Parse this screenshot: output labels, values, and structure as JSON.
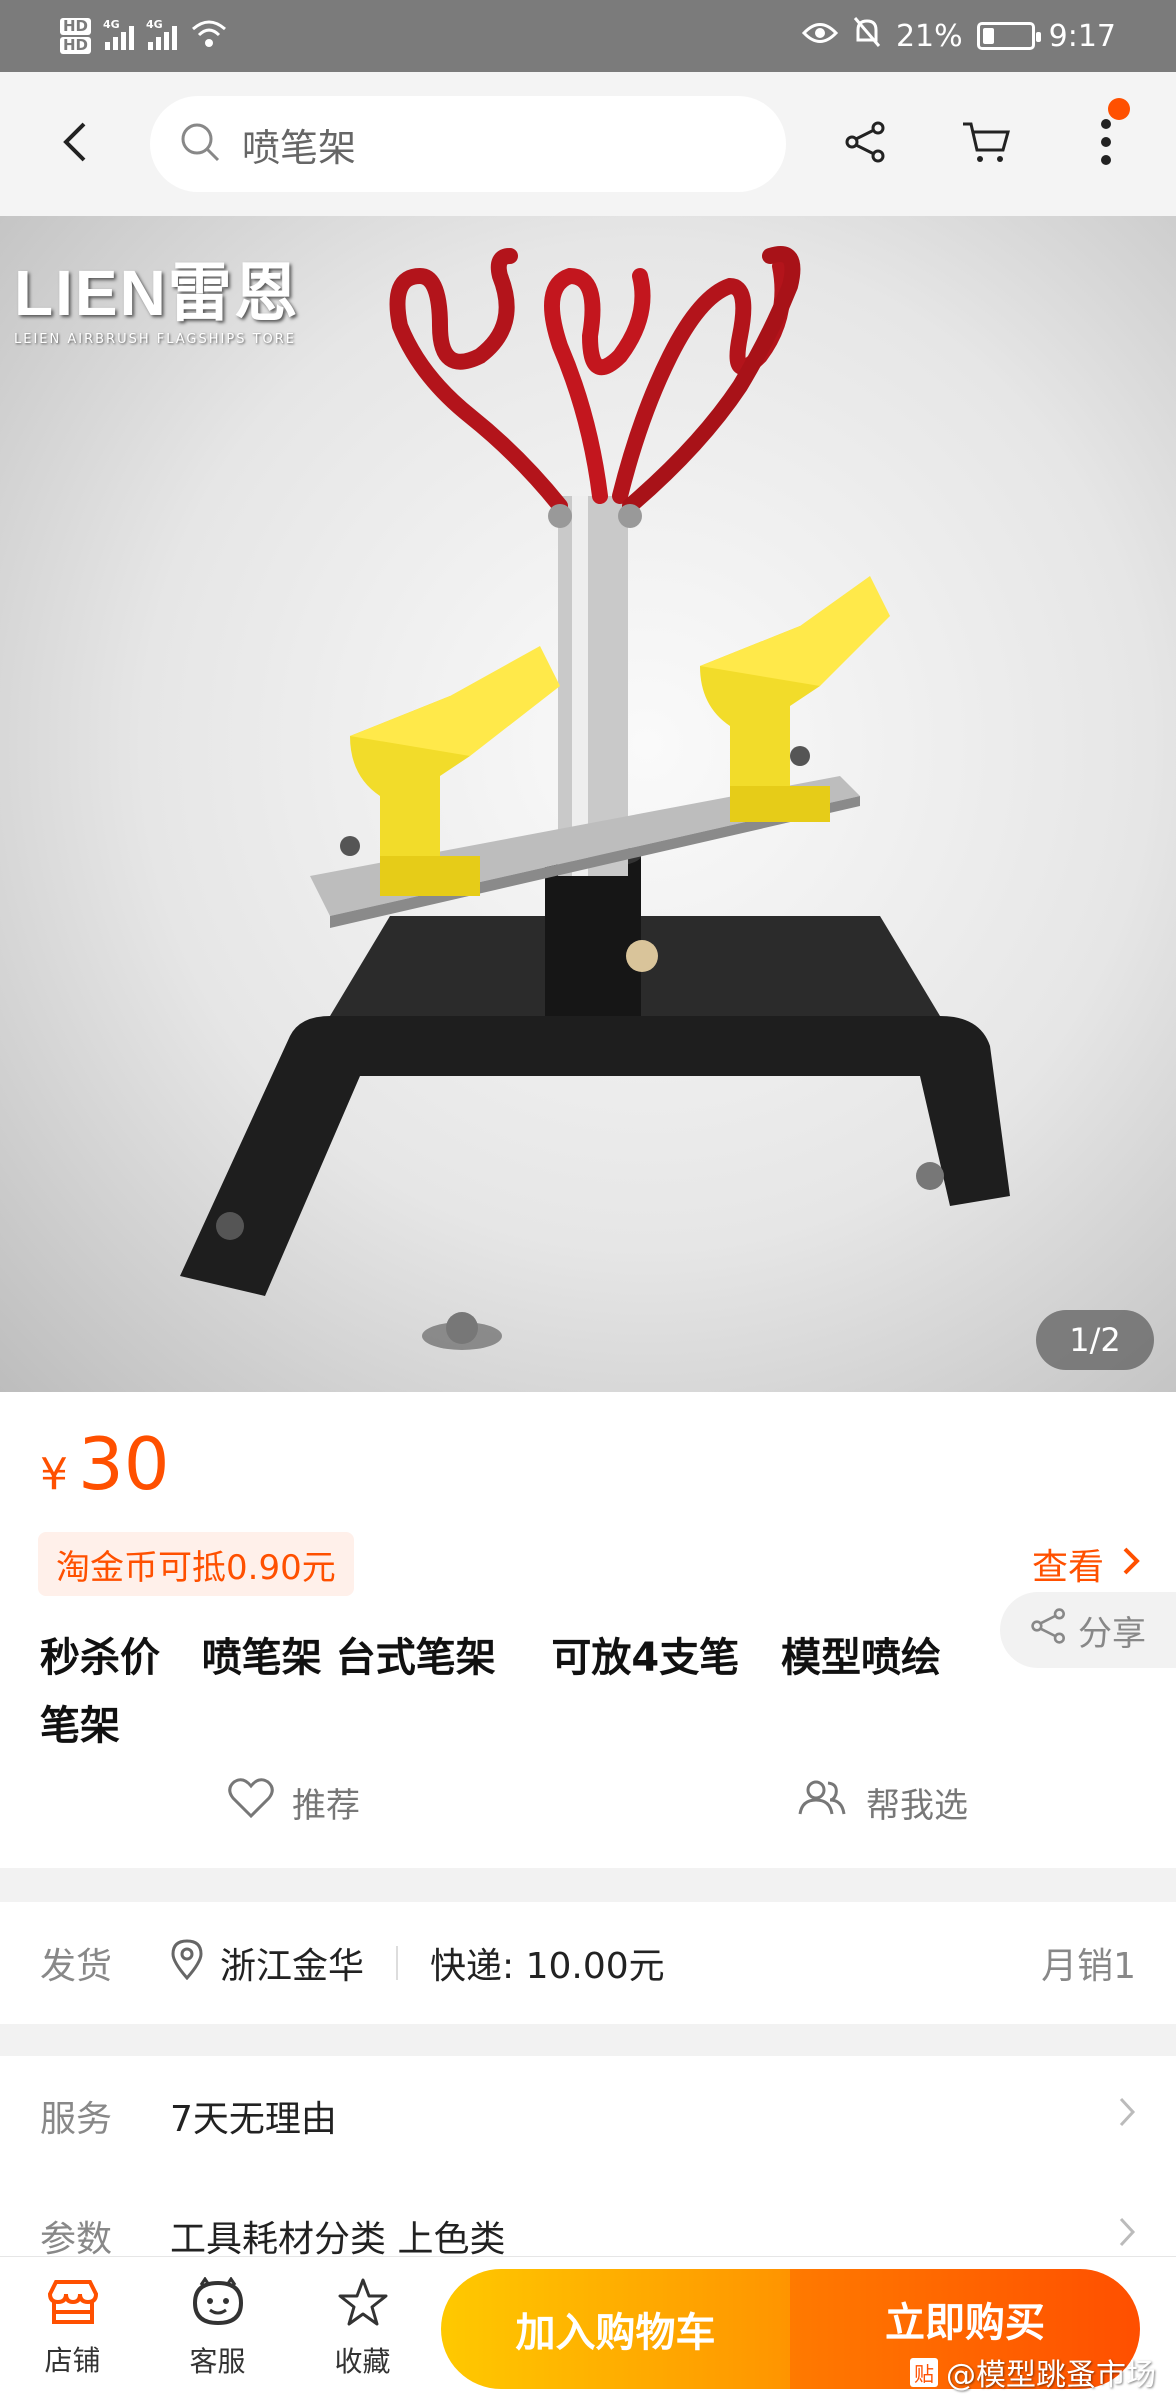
{
  "status_bar": {
    "hd1": "HD",
    "hd2": "HD",
    "net1": "4G",
    "net2": "4G",
    "battery_percent": "21%",
    "battery_level": 0.21,
    "time": "9:17",
    "icons": [
      "eye-icon",
      "bell-off-icon",
      "wifi-icon"
    ]
  },
  "header": {
    "search_query": "喷笔架",
    "icons": [
      "back-arrow-icon",
      "search-icon",
      "share-icon",
      "cart-icon",
      "more-icon"
    ],
    "badge_color": "#ff5000"
  },
  "gallery": {
    "brand_logo": "LIEN雷恩",
    "brand_sub": "LEIEN   AIRBRUSH   FLAGSHIPS   TORE",
    "counter": "1/2"
  },
  "product": {
    "currency": "¥",
    "price": "30",
    "coin_text": "淘金币可抵0.90元",
    "view_label": "查看",
    "title": "秒杀价   喷笔架 台式笔架    可放4支笔   模型喷绘笔架",
    "share_label": "分享",
    "recommend_label": "推荐",
    "help_choose_label": "帮我选",
    "accent_color": "#ff5000"
  },
  "delivery": {
    "label": "发货",
    "location": "浙江金华",
    "shipping": "快递: 10.00元",
    "monthly_sales": "月销1"
  },
  "service": {
    "label": "服务",
    "value": "7天无理由",
    "params_label": "参数",
    "params_value": "工具耗材分类 上色类"
  },
  "bottom_bar": {
    "store_label": "店铺",
    "service_label": "客服",
    "favorite_label": "收藏",
    "add_to_cart": "加入购物车",
    "buy_now": "立即购买",
    "watermark_tag": "贴",
    "watermark_text": "@模型跳蚤市场"
  }
}
